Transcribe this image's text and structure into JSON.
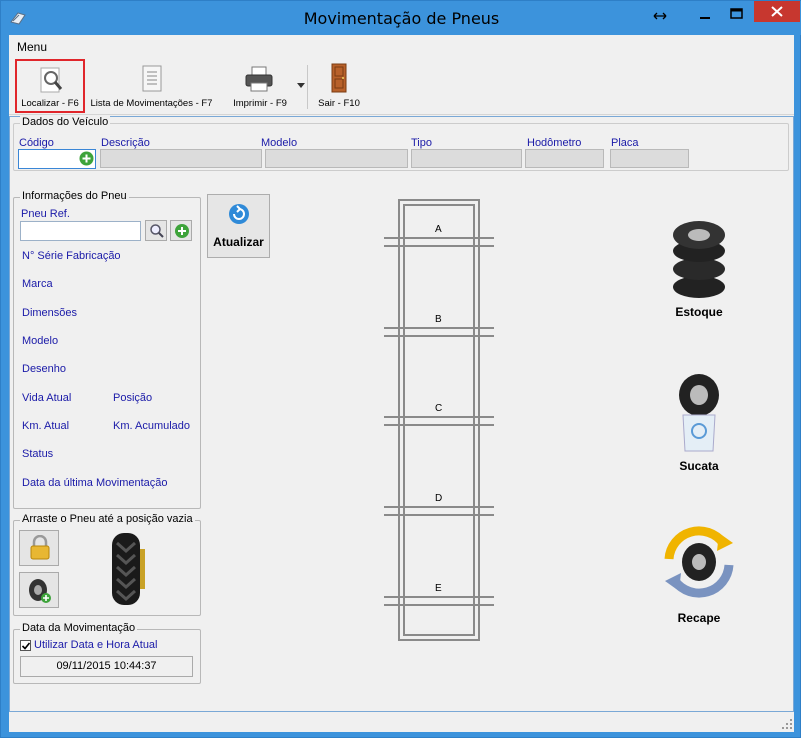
{
  "window": {
    "title": "Movimentação de Pneus",
    "controls": [
      "restore-icon",
      "minimize-icon",
      "maximize-icon",
      "close-icon"
    ],
    "close_color": "#c7372f"
  },
  "menu": {
    "label": "Menu"
  },
  "toolbar": {
    "localizar": "Localizar - F6",
    "lista": "Lista de Movimentações - F7",
    "imprimir": "Imprimir - F9",
    "sair": "Sair - F10",
    "highlight_color": "#e0262b"
  },
  "veiculo": {
    "title": "Dados do Veículo",
    "codigo": "Código",
    "descricao": "Descrição",
    "modelo": "Modelo",
    "tipo": "Tipo",
    "hodometro": "Hodômetro",
    "placa": "Placa"
  },
  "pneu": {
    "title": "Informações do Pneu",
    "ref": "Pneu Ref.",
    "serie": "N° Série Fabricação",
    "marca": "Marca",
    "dimensoes": "Dimensões",
    "modelo": "Modelo",
    "desenho": "Desenho",
    "vida": "Vida Atual",
    "posicao": "Posição",
    "km_atual": "Km. Atual",
    "km_acumulado": "Km. Acumulado",
    "status": "Status",
    "data_ultima": "Data da última Movimentação"
  },
  "atualizar": "Atualizar",
  "arraste": {
    "title": "Arraste o Pneu até a posição vazia"
  },
  "data_mov": {
    "title": "Data da Movimentação",
    "checkbox": "Utilizar Data e Hora Atual",
    "checked": true,
    "value": "09/11/2015  10:44:37"
  },
  "axles": [
    "A",
    "B",
    "C",
    "D",
    "E"
  ],
  "actions": {
    "estoque": "Estoque",
    "sucata": "Sucata",
    "recape": "Recape"
  }
}
